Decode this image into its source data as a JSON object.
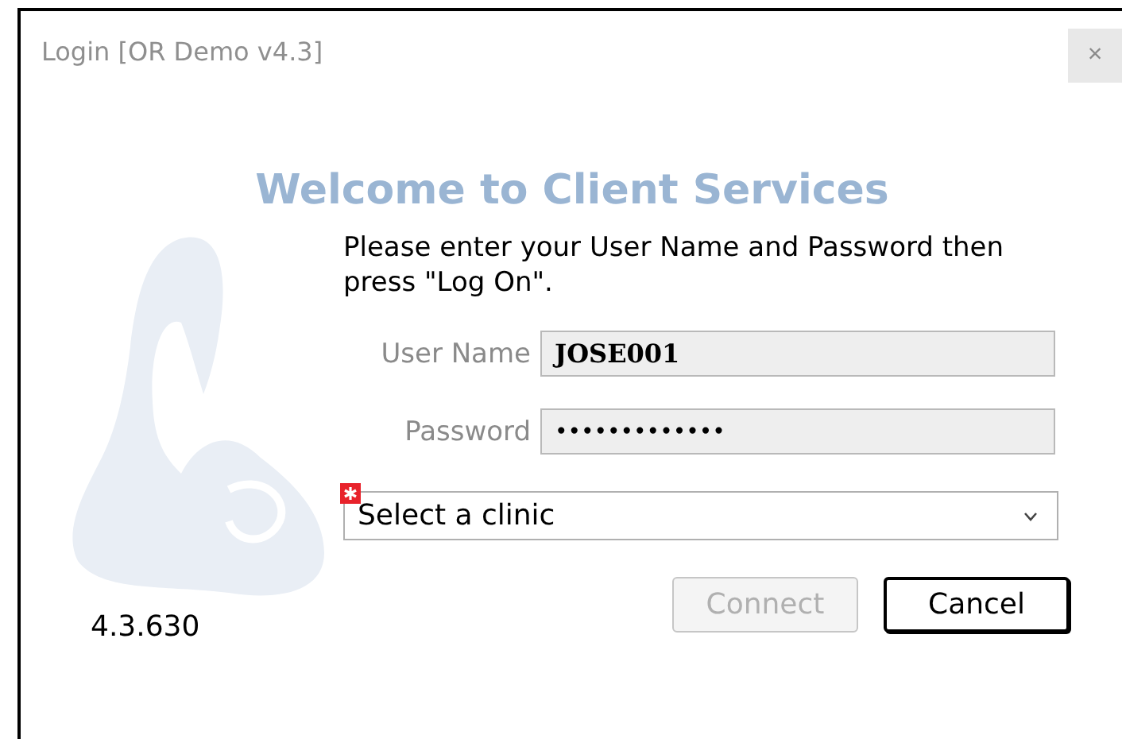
{
  "window": {
    "title": "Login [OR Demo v4.3]",
    "close": "×"
  },
  "heading": "Welcome to Client Services",
  "instructions": "Please enter your User Name and Password then press \"Log On\".",
  "fields": [
    {
      "label": "User Name",
      "value": "JOSE001",
      "kind": "text"
    },
    {
      "label": "Password",
      "value": "•••••••••••••",
      "kind": "password"
    }
  ],
  "clinic": {
    "value": "Select a clinic",
    "required": true
  },
  "version": "4.3.630",
  "buttons": [
    {
      "label": "Connect",
      "disabled": true,
      "default": false
    },
    {
      "label": "Cancel",
      "disabled": false,
      "default": true
    }
  ]
}
